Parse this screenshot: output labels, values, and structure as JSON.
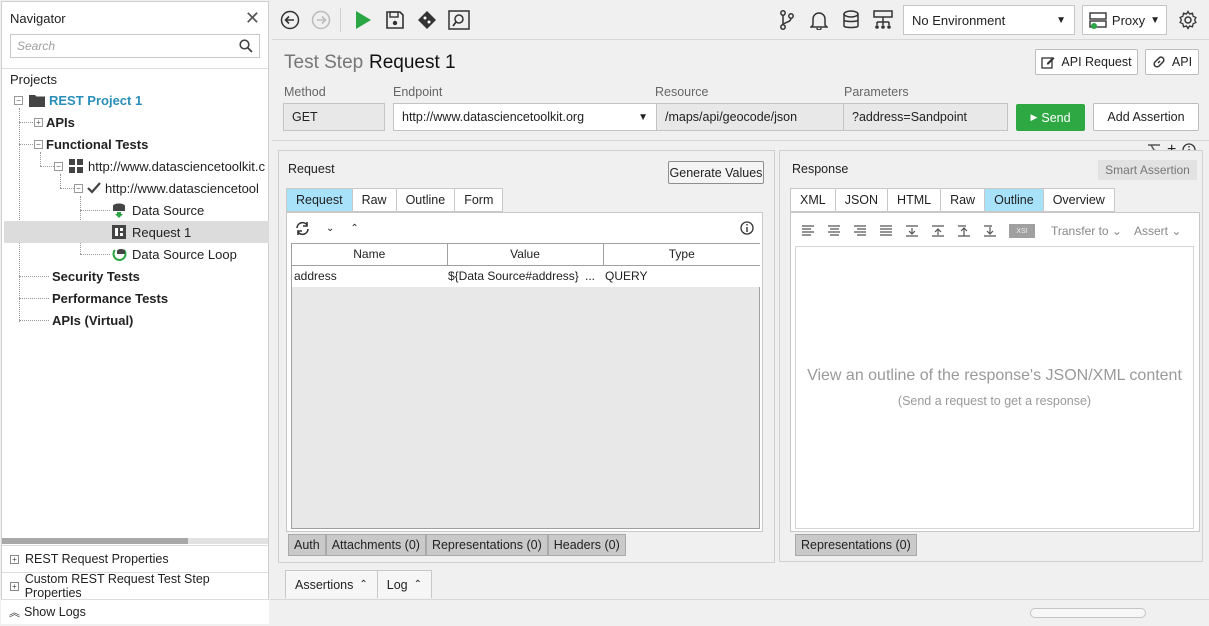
{
  "navigator": {
    "title": "Navigator",
    "search_placeholder": "Search",
    "projects_label": "Projects",
    "tree": {
      "project": "REST Project 1",
      "apis": "APIs",
      "functional_tests": "Functional Tests",
      "testsuite": "http://www.datasciencetoolkit.c",
      "testcase": "http://www.datasciencetool",
      "data_source": "Data Source",
      "request": "Request 1",
      "data_source_loop": "Data Source Loop",
      "security_tests": "Security Tests",
      "performance_tests": "Performance Tests",
      "virtual_apis": "APIs (Virtual)"
    },
    "footer": {
      "rest_request_properties": "REST Request Properties",
      "custom_properties": "Custom REST Request Test Step Properties",
      "show_logs": "Show Logs"
    }
  },
  "toolbar": {
    "environment": "No Environment",
    "proxy": "Proxy"
  },
  "step": {
    "kind": "Test Step",
    "name": "Request 1",
    "api_request_button": "API Request",
    "api_button": "API"
  },
  "request_line": {
    "method_label": "Method",
    "method": "GET",
    "endpoint_label": "Endpoint",
    "endpoint": "http://www.datasciencetoolkit.org",
    "resource_label": "Resource",
    "resource": "/maps/api/geocode/json",
    "parameters_label": "Parameters",
    "parameters": "?address=Sandpoint",
    "send_button": "Send",
    "add_assertion_button": "Add Assertion"
  },
  "request_panel": {
    "title": "Request",
    "generate_values_button": "Generate Values",
    "tabs": [
      "Request",
      "Raw",
      "Outline",
      "Form"
    ],
    "active_tab": "Request",
    "table": {
      "headers": [
        "Name",
        "Value",
        "Type"
      ],
      "rows": [
        {
          "name": "address",
          "value": "${Data Source#address}",
          "more": "...",
          "type": "QUERY"
        }
      ]
    },
    "bottom_tabs": [
      "Auth",
      "Attachments (0)",
      "Representations (0)",
      "Headers (0)"
    ]
  },
  "response_panel": {
    "title": "Response",
    "smart_assertion_button": "Smart Assertion",
    "tabs": [
      "XML",
      "JSON",
      "HTML",
      "Raw",
      "Outline",
      "Overview"
    ],
    "active_tab": "Outline",
    "transfer_to": "Transfer to",
    "assert": "Assert",
    "empty_title": "View an outline of the response's JSON/XML content",
    "empty_hint": "(Send a request to get a response)",
    "bottom_tabs": [
      "Representations (0)"
    ]
  },
  "bottom_bar": {
    "assertions_tab": "Assertions",
    "log_tab": "Log"
  },
  "colors": {
    "active_tab": "#a7e1fa",
    "send_button": "#2ea843",
    "project_link": "#2a8fb8",
    "run_green": "#2aa644"
  }
}
